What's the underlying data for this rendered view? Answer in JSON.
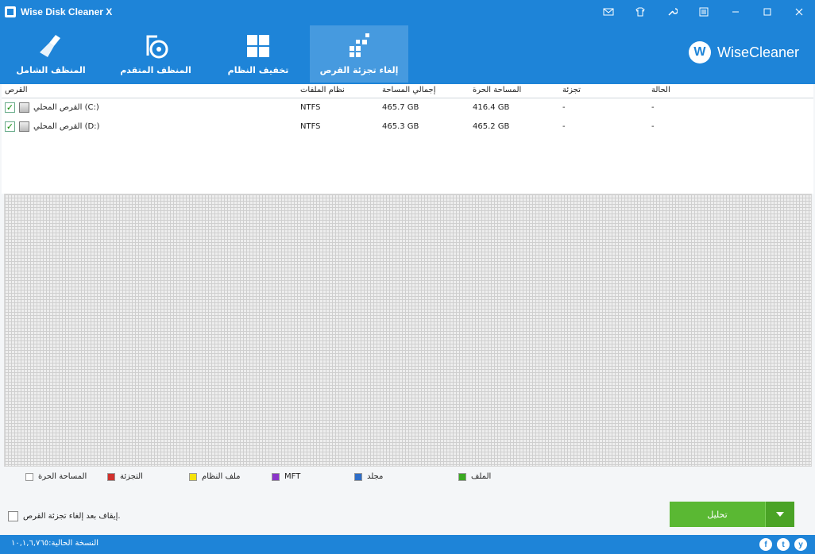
{
  "window": {
    "title": "Wise Disk Cleaner X"
  },
  "toolbar": {
    "items": [
      {
        "label": "المنظف الشامل",
        "icon": "broom-icon"
      },
      {
        "label": "المنظف المتقدم",
        "icon": "vacuum-icon"
      },
      {
        "label": "تخفيف النظام",
        "icon": "windows-icon"
      },
      {
        "label": "إلغاء تجزئة القرص",
        "icon": "defrag-icon",
        "active": true
      }
    ],
    "brand": {
      "logo_letter": "W",
      "name": "WiseCleaner"
    }
  },
  "table": {
    "headers": {
      "disk": "القرص",
      "filesystem": "نظام الملفات",
      "total": "إجمالي المساحة",
      "free": "المساحة الحرة",
      "fragmentation": "تجزئة",
      "status": "الحالة"
    },
    "rows": [
      {
        "name": "القرص المحلي (C:)",
        "filesystem": "NTFS",
        "total": "465.7 GB",
        "free": "416.4 GB",
        "fragmentation": "-",
        "status": "-"
      },
      {
        "name": "القرص المحلي (D:)",
        "filesystem": "NTFS",
        "total": "465.3 GB",
        "free": "465.2 GB",
        "fragmentation": "-",
        "status": "-"
      }
    ]
  },
  "legend": [
    {
      "label": "المساحة الحرة",
      "color": "#ffffff"
    },
    {
      "label": "التجزئة",
      "color": "#d0312d"
    },
    {
      "label": "ملف النظام",
      "color": "#f5e20a"
    },
    {
      "label": "MFT",
      "color": "#8a35c9"
    },
    {
      "label": "مجلد",
      "color": "#2f6ec8"
    },
    {
      "label": "الملف",
      "color": "#3aaa20"
    }
  ],
  "options": {
    "shutdown_label": "إيقاف بعد إلغاء تجزئة القرص."
  },
  "actions": {
    "analyze_label": "تحليل"
  },
  "statusbar": {
    "version": "النسخة الحالية:١٠,١,٦,٧٦٥",
    "social": [
      "f",
      "t",
      "y"
    ]
  }
}
